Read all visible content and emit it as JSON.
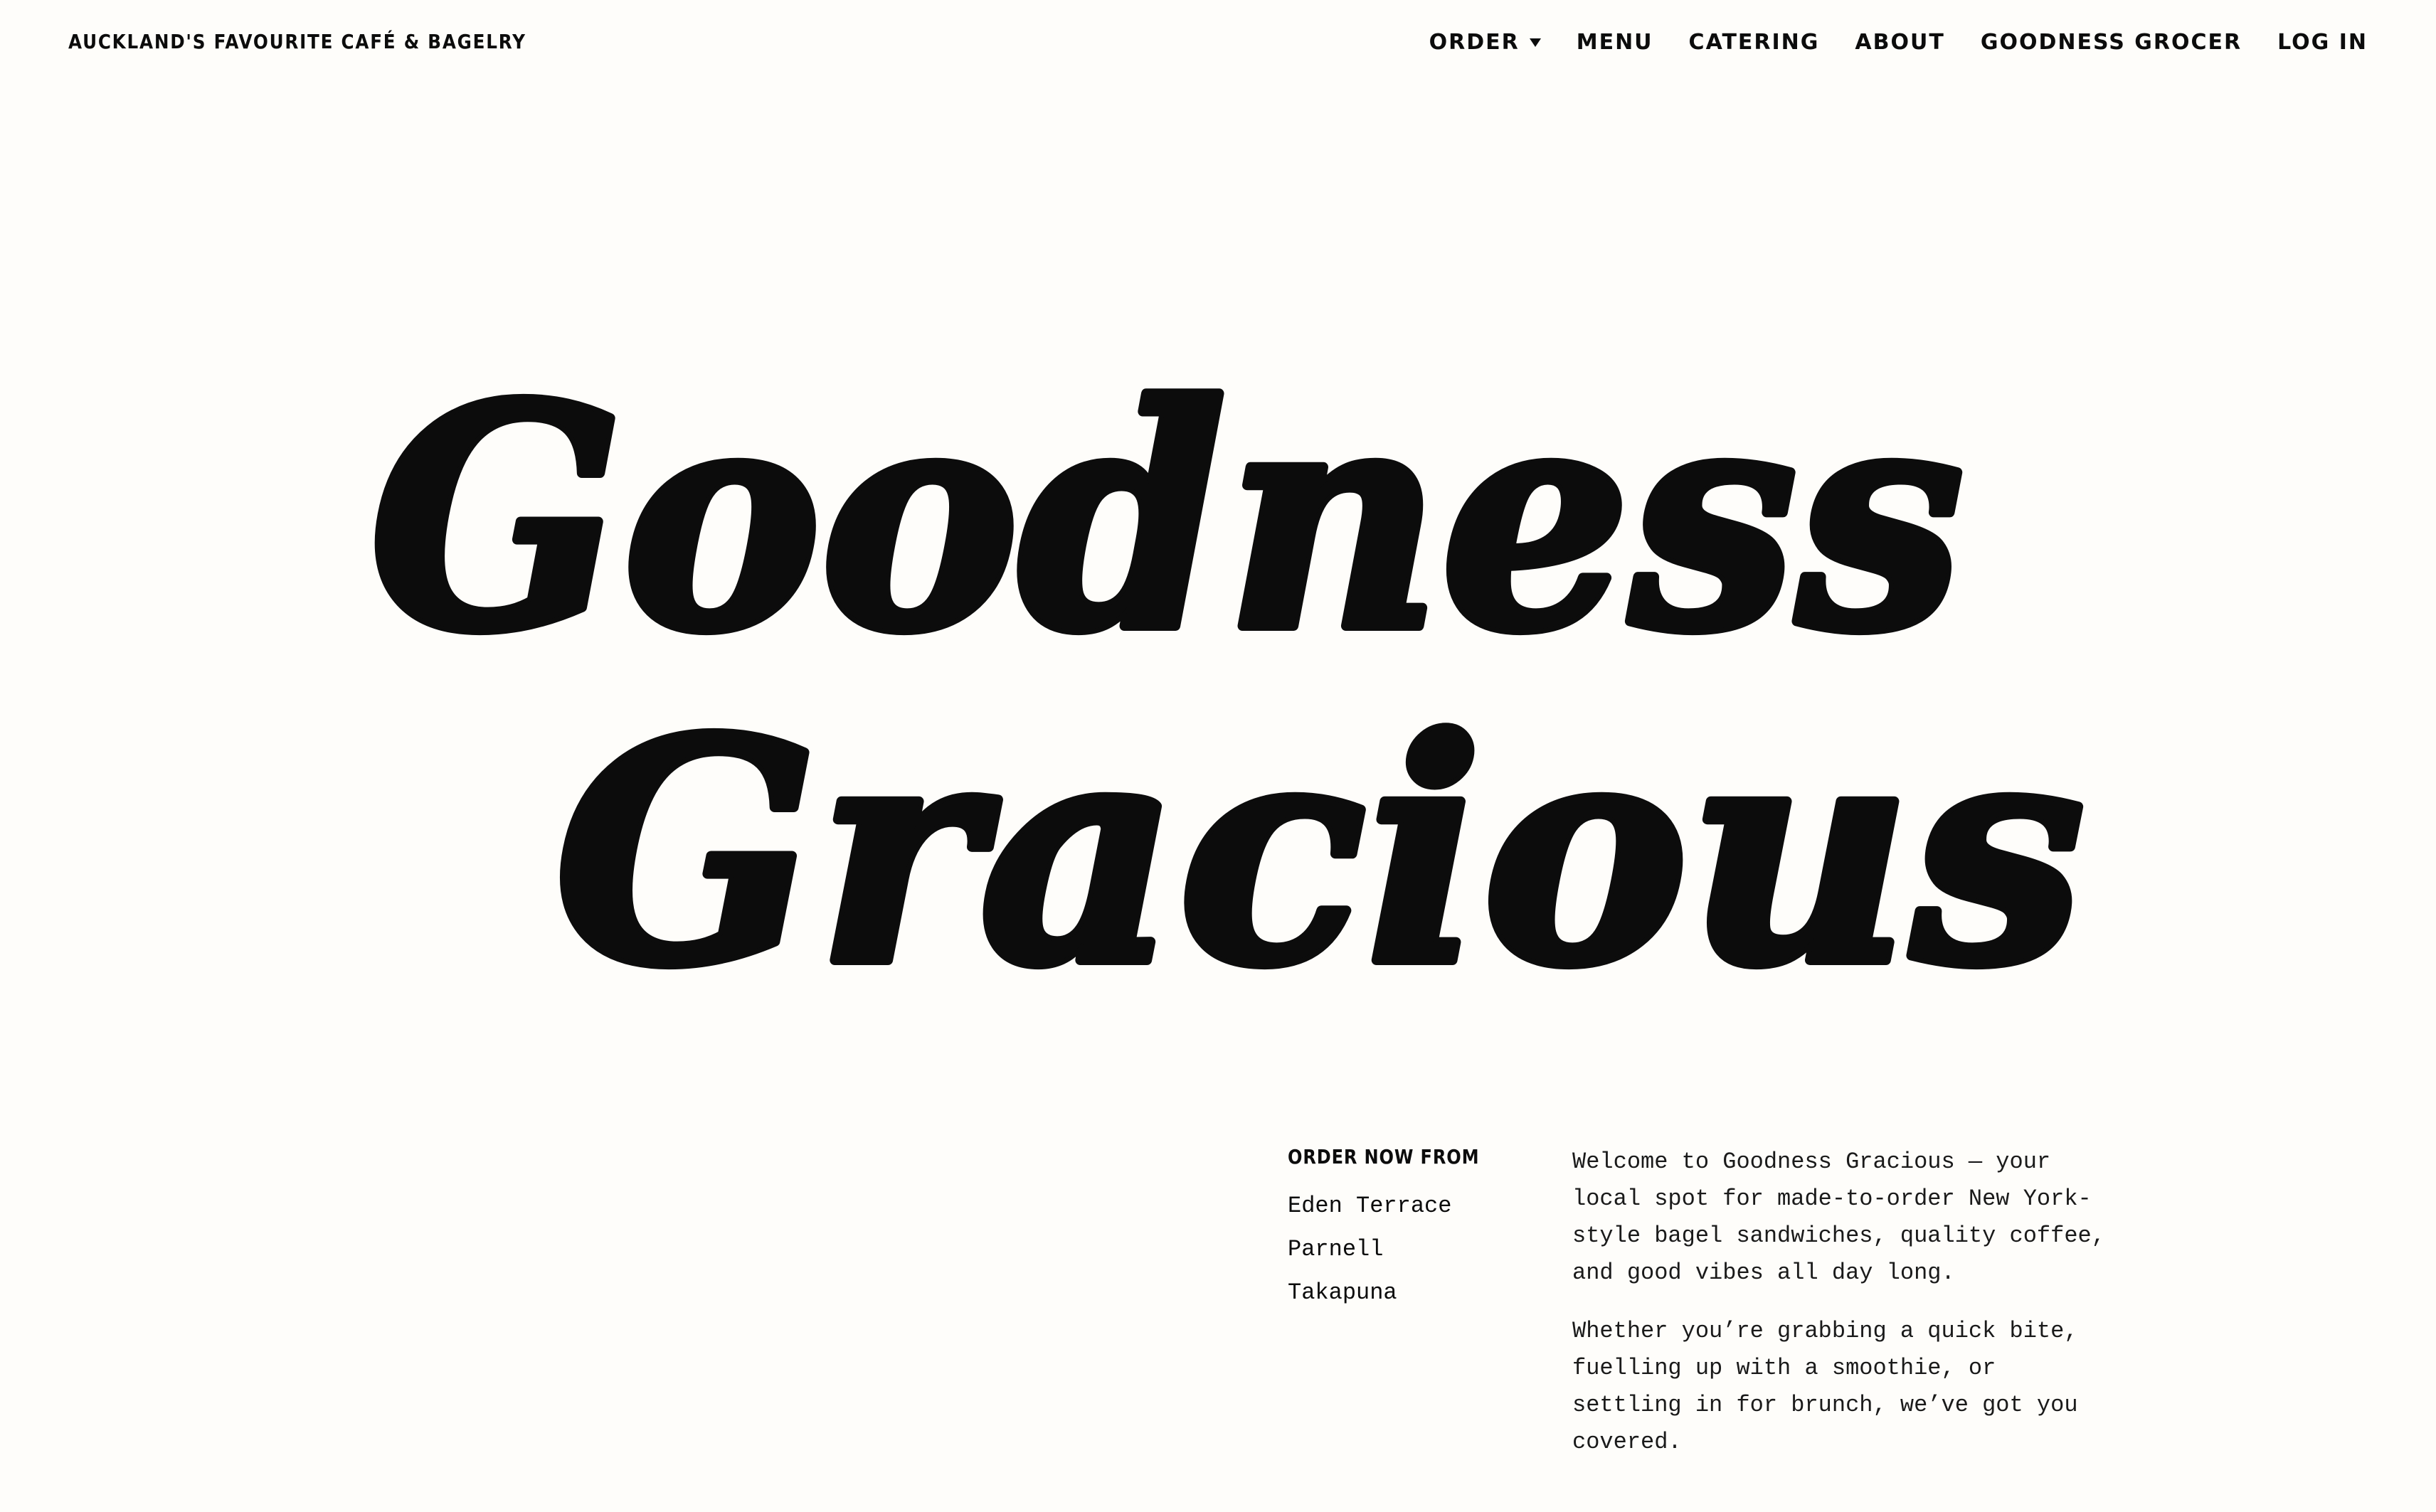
{
  "header": {
    "tagline": "AUCKLAND'S FAVOURITE CAFÉ & BAGELRY",
    "nav": [
      {
        "label": "ORDER",
        "has_dropdown": true
      },
      {
        "label": "MENU"
      },
      {
        "label": "CATERING"
      },
      {
        "label": "ABOUT"
      },
      {
        "label": "GOODNESS GROCER"
      },
      {
        "label": "LOG IN"
      }
    ]
  },
  "hero": {
    "logo_line_1": "Goodness",
    "logo_line_2": "Gracious"
  },
  "order": {
    "heading": "ORDER NOW FROM",
    "locations": [
      "Eden Terrace",
      "Parnell",
      "Takapuna"
    ]
  },
  "intro": {
    "paragraph_1": "Welcome to Goodness Gracious — your local spot for made-to-order New York-style bagel sandwiches, quality coffee, and good vibes all day long.",
    "paragraph_2": "Whether you’re grabbing a quick bite, fuelling up with a smoothie, or settling in for brunch, we’ve got you covered."
  },
  "colors": {
    "background": "#fefdfa",
    "ink": "#0c0c0c"
  },
  "icons": {
    "order_dropdown": "caret-down-icon"
  }
}
